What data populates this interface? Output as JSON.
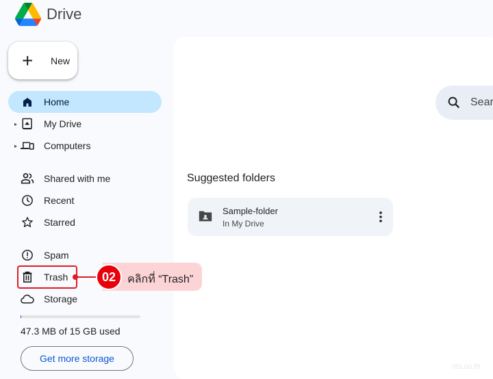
{
  "app": {
    "title": "Drive",
    "logo_icon": "google-drive-logo"
  },
  "new_button": {
    "label": "New",
    "icon": "plus-icon"
  },
  "sidebar": {
    "items": [
      {
        "label": "Home",
        "icon": "home-icon",
        "active": true,
        "expandable": false
      },
      {
        "label": "My Drive",
        "icon": "my-drive-icon",
        "active": false,
        "expandable": true
      },
      {
        "label": "Computers",
        "icon": "computers-icon",
        "active": false,
        "expandable": true
      },
      {
        "label": "Shared with me",
        "icon": "people-icon",
        "active": false,
        "expandable": false
      },
      {
        "label": "Recent",
        "icon": "clock-icon",
        "active": false,
        "expandable": false
      },
      {
        "label": "Starred",
        "icon": "star-icon",
        "active": false,
        "expandable": false
      },
      {
        "label": "Spam",
        "icon": "spam-icon",
        "active": false,
        "expandable": false
      },
      {
        "label": "Trash",
        "icon": "trash-icon",
        "active": false,
        "expandable": false
      },
      {
        "label": "Storage",
        "icon": "cloud-icon",
        "active": false,
        "expandable": false
      }
    ]
  },
  "storage": {
    "used_text": "47.3 MB of 15 GB used",
    "used_fraction": 0.003,
    "button_label": "Get more storage"
  },
  "search": {
    "placeholder": "Sear"
  },
  "main": {
    "suggested_title": "Suggested folders",
    "folders": [
      {
        "name": "Sample-folder",
        "location": "In My Drive",
        "icon": "shared-folder-icon"
      }
    ]
  },
  "annotation": {
    "step_number": "02",
    "text": "คลิกที่  “Trash”",
    "color": "#e8000b"
  },
  "watermark": "nts.co.th"
}
